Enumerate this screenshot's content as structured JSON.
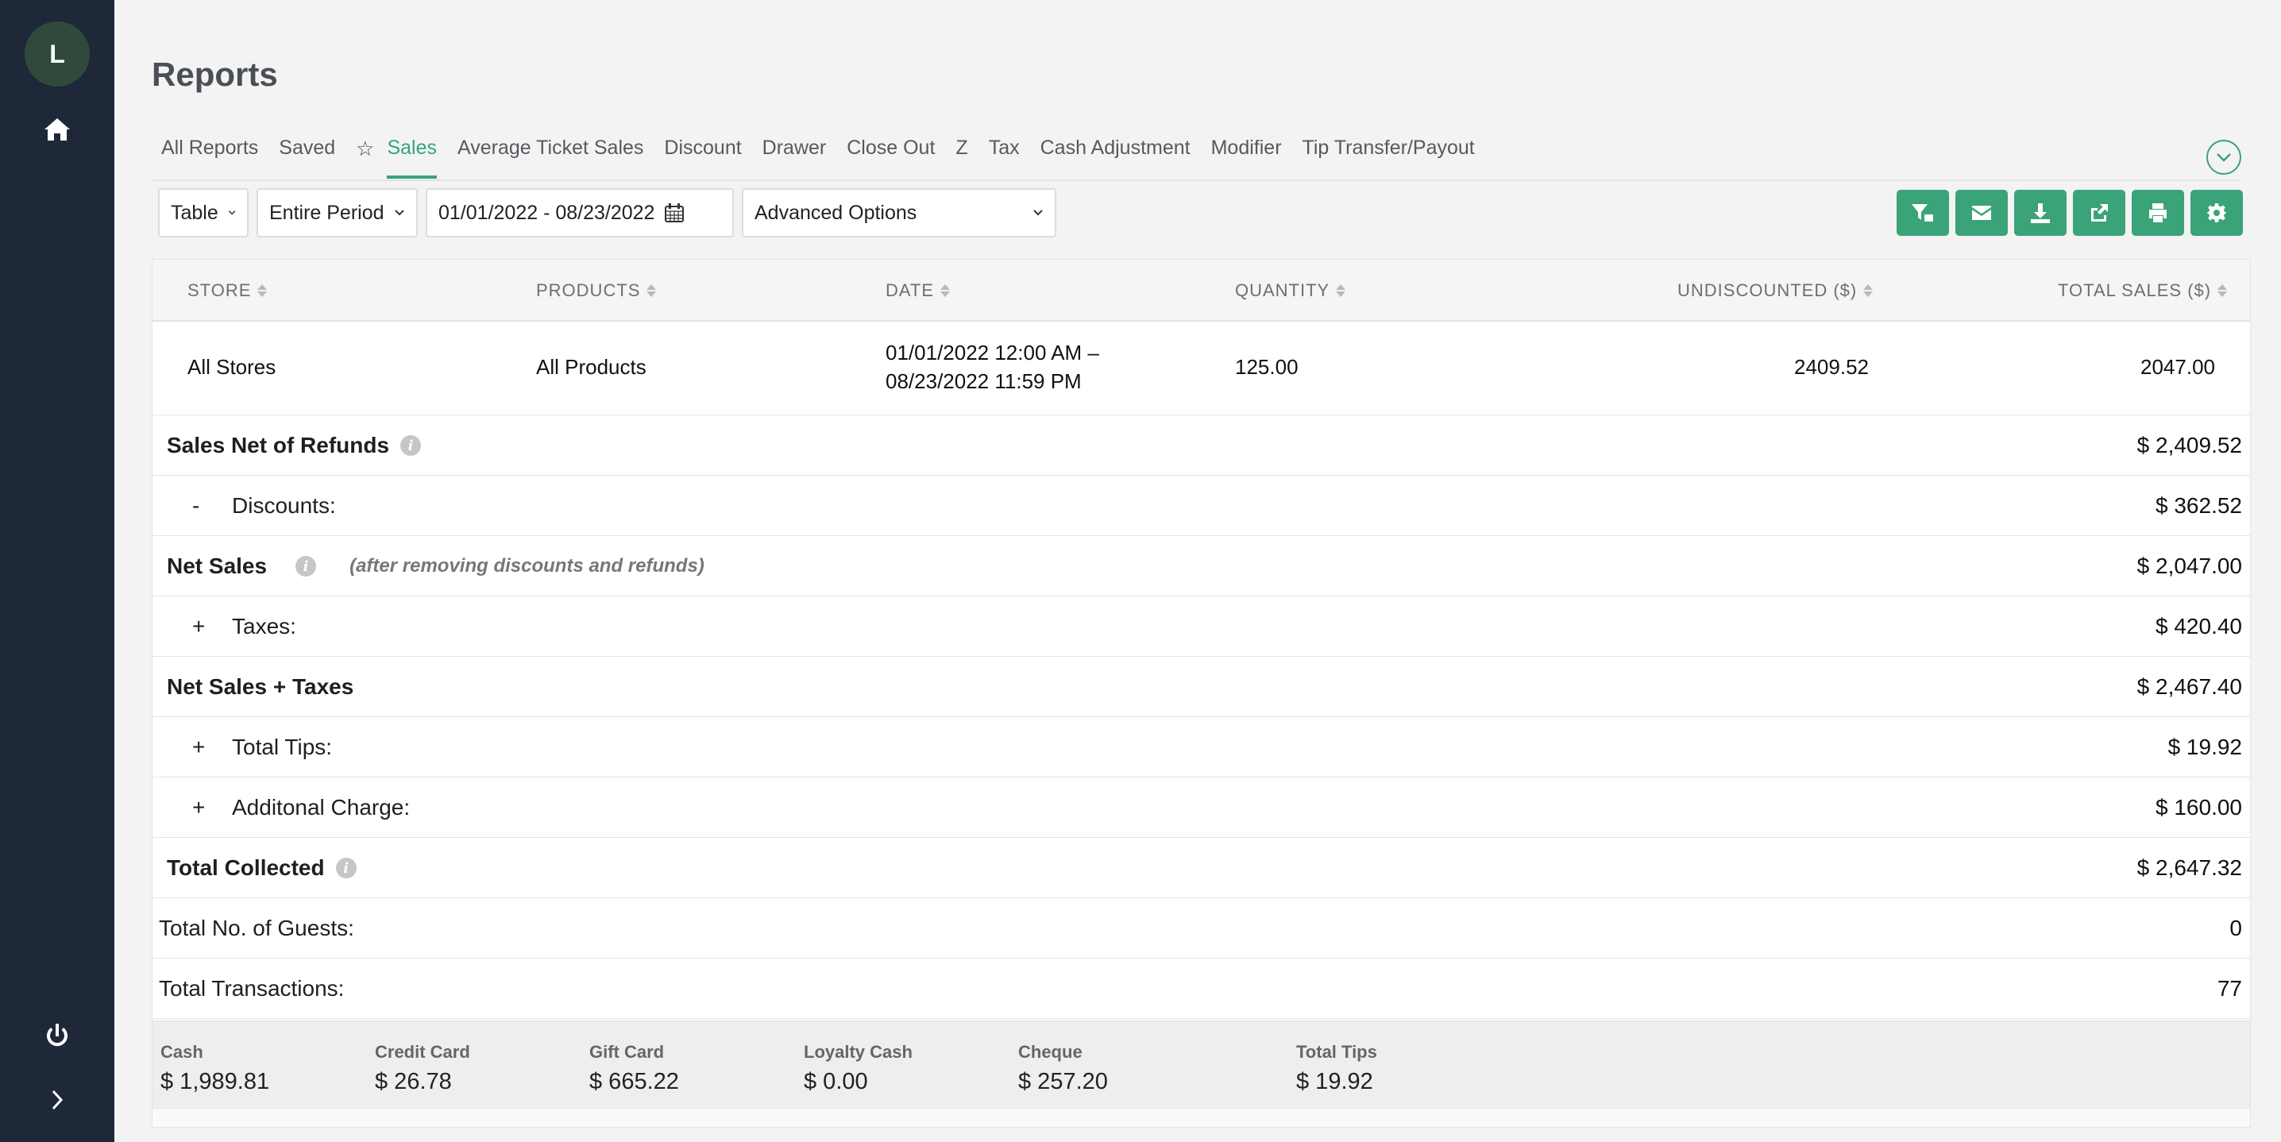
{
  "sidebar": {
    "avatar_initial": "L",
    "icons": [
      "home-icon",
      "power-icon",
      "chevron-right-icon"
    ]
  },
  "page": {
    "title": "Reports"
  },
  "tabs": [
    {
      "label": "All Reports",
      "active": false
    },
    {
      "label": "Saved",
      "active": false
    },
    {
      "label": "Sales",
      "active": true
    },
    {
      "label": "Average Ticket Sales",
      "active": false
    },
    {
      "label": "Discount",
      "active": false
    },
    {
      "label": "Drawer",
      "active": false
    },
    {
      "label": "Close Out",
      "active": false
    },
    {
      "label": "Z",
      "active": false
    },
    {
      "label": "Tax",
      "active": false
    },
    {
      "label": "Cash Adjustment",
      "active": false
    },
    {
      "label": "Modifier",
      "active": false
    },
    {
      "label": "Tip Transfer/Payout",
      "active": false
    }
  ],
  "toolbar": {
    "view": "Table",
    "period": "Entire Period",
    "date_range": "01/01/2022 - 08/23/2022",
    "advanced": "Advanced Options",
    "actions": [
      "filter-icon",
      "email-icon",
      "download-icon",
      "share-icon",
      "print-icon",
      "settings-icon"
    ]
  },
  "table": {
    "headers": [
      "STORE",
      "PRODUCTS",
      "DATE",
      "QUANTITY",
      "UNDISCOUNTED ($)",
      "TOTAL SALES ($)"
    ],
    "row": {
      "store": "All Stores",
      "products": "All Products",
      "date_line1": "01/01/2022 12:00 AM –",
      "date_line2": "08/23/2022 11:59 PM",
      "quantity": "125.00",
      "undiscounted": "2409.52",
      "total_sales": "2047.00"
    }
  },
  "summary": {
    "sales_net_refunds": {
      "label": "Sales Net of Refunds",
      "value": "$ 2,409.52"
    },
    "discounts": {
      "op": "-",
      "label": "Discounts:",
      "value": "$ 362.52"
    },
    "net_sales": {
      "label": "Net Sales",
      "note": "(after removing discounts and refunds)",
      "value": "$ 2,047.00"
    },
    "taxes": {
      "op": "+",
      "label": "Taxes:",
      "value": "$ 420.40"
    },
    "net_sales_taxes": {
      "label": "Net Sales + Taxes",
      "value": "$ 2,467.40"
    },
    "total_tips": {
      "op": "+",
      "label": "Total Tips:",
      "value": "$ 19.92"
    },
    "additional_charge": {
      "op": "+",
      "label": "Additonal Charge:",
      "value": "$ 160.00"
    },
    "total_collected": {
      "label": "Total Collected",
      "value": "$ 2,647.32"
    },
    "guests": {
      "label": "Total No. of Guests:",
      "value": "0"
    },
    "transactions": {
      "label": "Total Transactions:",
      "value": "77"
    }
  },
  "payments": [
    {
      "label": "Cash",
      "value": "$ 1,989.81"
    },
    {
      "label": "Credit Card",
      "value": "$ 26.78"
    },
    {
      "label": "Gift Card",
      "value": "$ 665.22"
    },
    {
      "label": "Loyalty Cash",
      "value": "$ 0.00"
    },
    {
      "label": "Cheque",
      "value": "$ 257.20"
    },
    {
      "label": "Total Tips",
      "value": "$ 19.92"
    }
  ],
  "colors": {
    "accent": "#3aa378",
    "sidebar": "#1e2838",
    "avatar": "#2f4a3c"
  }
}
